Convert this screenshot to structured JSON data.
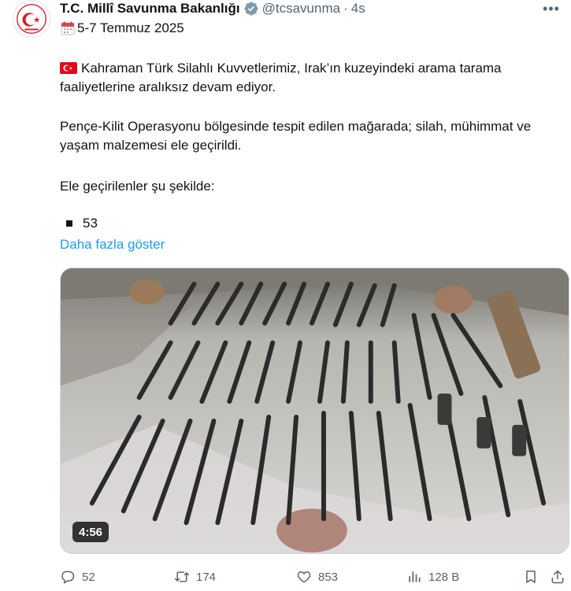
{
  "author": {
    "display_name": "T.C. Millî Savunma Bakanlığı",
    "handle": "@tcsavunma",
    "separator": "·",
    "time": "4s",
    "avatar_icon": "ministry-crescent-star-logo",
    "verified_icon": "gray-verified-badge-icon",
    "verified_color": "#829aab"
  },
  "tweet": {
    "date_icon": "calendar-emoji-icon",
    "date_text": "5-7 Temmuz 2025",
    "flag_icon": "turkey-flag-emoji-icon",
    "paragraph1": "Kahraman Türk Silahlı Kuvvetlerimiz, Irak’ın kuzeyindeki arama tarama faaliyetlerine aralıksız devam ediyor.",
    "paragraph2": "Pençe-Kilit Operasyonu bölgesinde tespit edilen mağarada; silah, mühimmat ve yaşam malzemesi ele geçirildi.",
    "paragraph3": "Ele geçirilenler şu şekilde:",
    "bullet_value": "53",
    "show_more": "Daha fazla göster"
  },
  "media": {
    "type": "video",
    "duration": "4:56",
    "description_icon": "seized-rifles-on-tarp-thumbnail"
  },
  "actions": {
    "replies": "52",
    "reposts": "174",
    "likes": "853",
    "views": "128 B"
  },
  "colors": {
    "text": "#0f1419",
    "secondary": "#536471",
    "link": "#1d9bf0",
    "flag_red": "#e30a17"
  }
}
